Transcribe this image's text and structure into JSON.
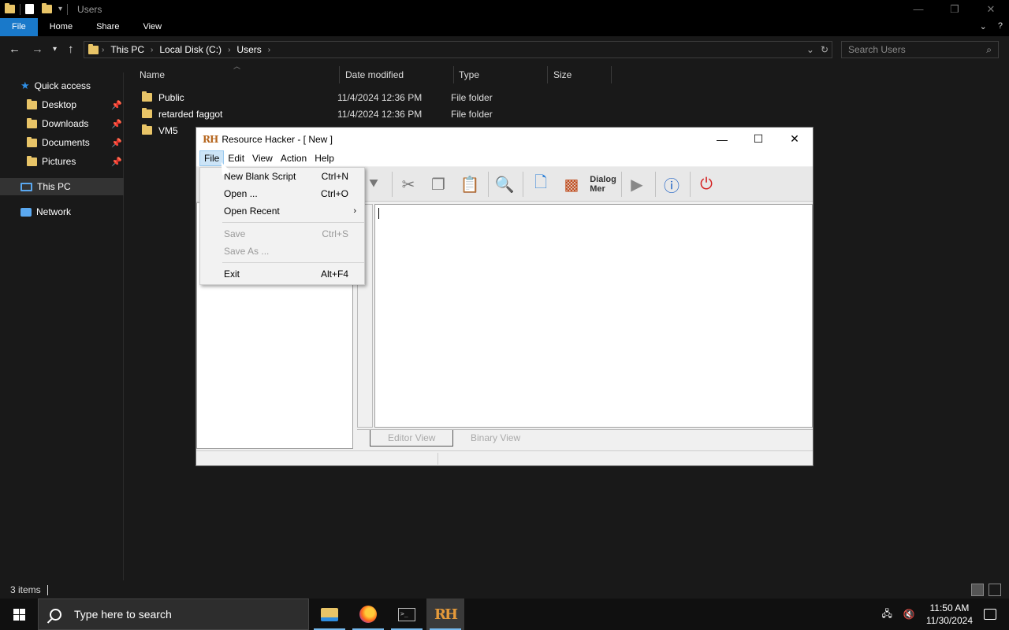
{
  "explorer": {
    "window_title": "Users",
    "ribbon_tabs": [
      "File",
      "Home",
      "Share",
      "View"
    ],
    "breadcrumbs": [
      "This PC",
      "Local Disk (C:)",
      "Users"
    ],
    "search_placeholder": "Search Users",
    "columns": [
      "Name",
      "Date modified",
      "Type",
      "Size"
    ],
    "files": [
      {
        "name": "Public",
        "date": "11/4/2024 12:36 PM",
        "type": "File folder"
      },
      {
        "name": "retarded faggot",
        "date": "11/4/2024 12:36 PM",
        "type": "File folder"
      },
      {
        "name": "VM5",
        "date": "",
        "type": ""
      }
    ],
    "sidebar": {
      "quick_access": "Quick access",
      "items": [
        "Desktop",
        "Downloads",
        "Documents",
        "Pictures"
      ],
      "this_pc": "This PC",
      "network": "Network"
    },
    "status": "3 items"
  },
  "resource_hacker": {
    "logo": "RH",
    "title": "Resource Hacker - [ New ]",
    "menu": [
      "File",
      "Edit",
      "View",
      "Action",
      "Help"
    ],
    "toolbar_dialog_label_1": "Dialog",
    "toolbar_dialog_label_2": "Mer",
    "file_menu": [
      {
        "label": "New Blank Script",
        "shortcut": "Ctrl+N",
        "enabled": true
      },
      {
        "label": "Open ...",
        "shortcut": "Ctrl+O",
        "enabled": true
      },
      {
        "label": "Open Recent",
        "shortcut": "",
        "enabled": true,
        "submenu": true
      },
      {
        "label": "Save",
        "shortcut": "Ctrl+S",
        "enabled": false
      },
      {
        "label": "Save As ...",
        "shortcut": "",
        "enabled": false
      },
      {
        "label": "Exit",
        "shortcut": "Alt+F4",
        "enabled": true
      }
    ],
    "view_tabs": [
      "Editor View",
      "Binary View"
    ]
  },
  "taskbar": {
    "search_placeholder": "Type here to search",
    "time": "11:50 AM",
    "date": "11/30/2024",
    "rh_label": "RH"
  },
  "colors": {
    "accent": "#1979ca",
    "explorer_bg": "#191919",
    "menu_highlight": "#cce4f7"
  }
}
